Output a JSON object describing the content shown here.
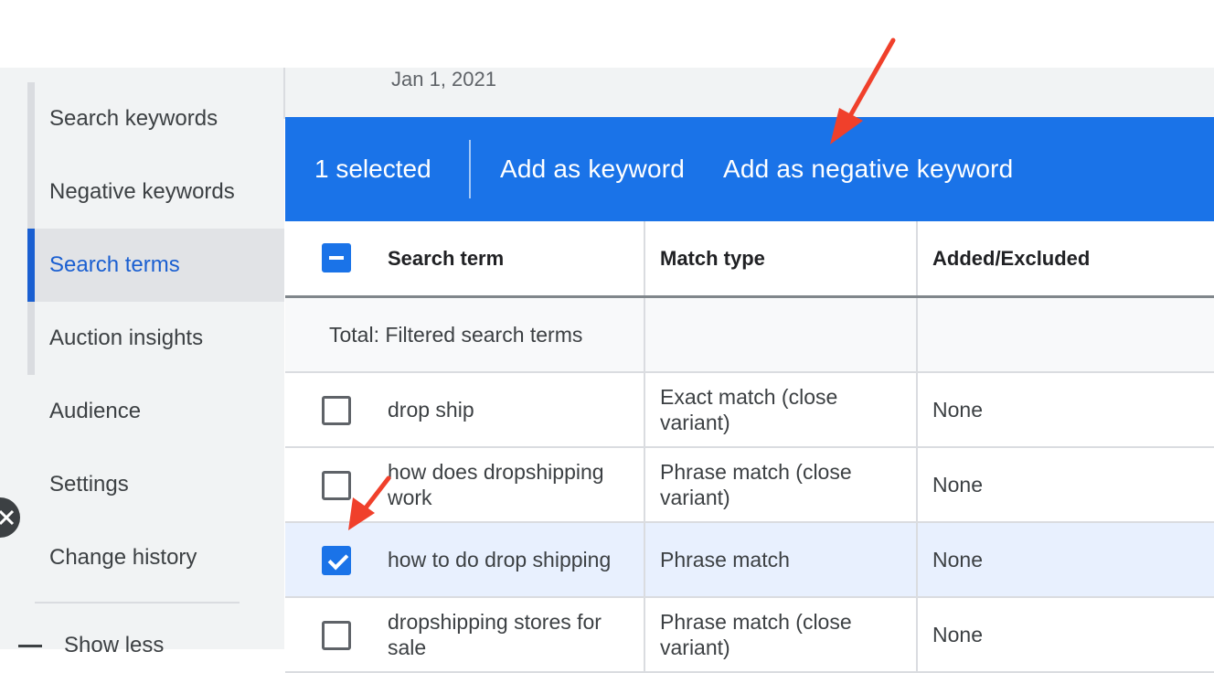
{
  "sidebar": {
    "items": [
      {
        "label": "Search keywords",
        "active": false
      },
      {
        "label": "Negative keywords",
        "active": false
      },
      {
        "label": "Search terms",
        "active": true
      },
      {
        "label": "Auction insights",
        "active": false
      },
      {
        "label": "Audience",
        "active": false
      },
      {
        "label": "Settings",
        "active": false
      },
      {
        "label": "Change history",
        "active": false
      }
    ],
    "show_less_label": "Show less"
  },
  "main": {
    "date_text": "Jan 1, 2021"
  },
  "action_bar": {
    "selected_label": "1 selected",
    "add_keyword_label": "Add as keyword",
    "add_negative_label": "Add as negative keyword",
    "color": "#1a73e8"
  },
  "table": {
    "headers": [
      "Search term",
      "Match type",
      "Added/Excluded"
    ],
    "header_checkbox_state": "indeterminate",
    "total_label": "Total: Filtered search terms",
    "rows": [
      {
        "term": "drop ship",
        "match_type": "Exact match (close variant)",
        "added_excluded": "None",
        "checked": false
      },
      {
        "term": "how does dropshipping work",
        "match_type": "Phrase match (close variant)",
        "added_excluded": "None",
        "checked": false
      },
      {
        "term": "how to do drop shipping",
        "match_type": "Phrase match",
        "added_excluded": "None",
        "checked": true
      },
      {
        "term": "dropshipping stores for sale",
        "match_type": "Phrase match (close variant)",
        "added_excluded": "None",
        "checked": false
      }
    ]
  },
  "annotations": {
    "arrow_color": "#f0402b"
  }
}
